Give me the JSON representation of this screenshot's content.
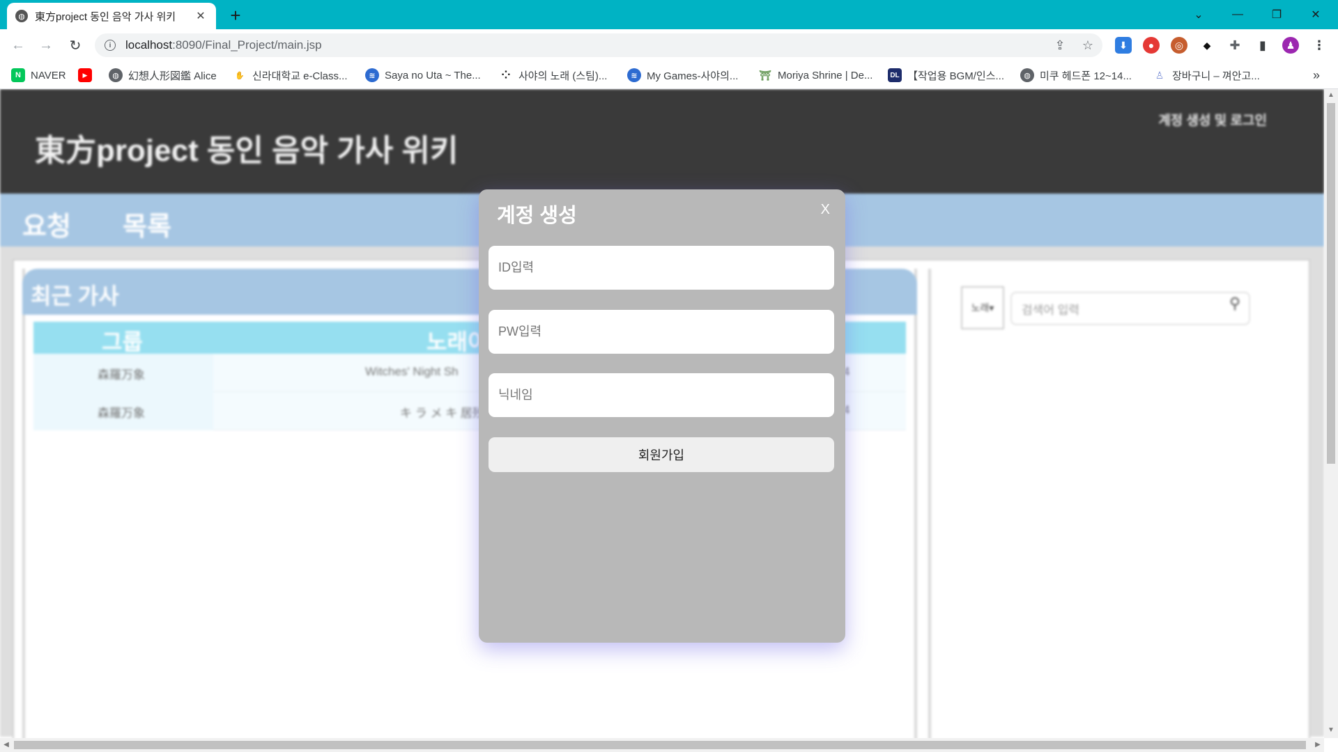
{
  "browser": {
    "tab_title": "東方project 동인 음악 가사 위키",
    "tab_close": "✕",
    "new_tab": "+",
    "url_host": "localhost",
    "url_path": ":8090/Final_Project/main.jsp",
    "window_controls": {
      "tab_search": "⌄",
      "minimize": "—",
      "restore": "❐",
      "close": "✕"
    }
  },
  "bookmarks": [
    {
      "label": "NAVER",
      "icon": "naver-icon",
      "color": "#03c75a",
      "glyph": "N"
    },
    {
      "label": "",
      "icon": "youtube-icon",
      "color": "#ff0000",
      "glyph": "▶"
    },
    {
      "label": "幻想人形図鑑 Alice",
      "icon": "globe-icon",
      "color": "#5f6368",
      "glyph": "◍"
    },
    {
      "label": "신라대학교 e-Class...",
      "icon": "hand-icon",
      "color": "#e9a23b",
      "glyph": "✋"
    },
    {
      "label": "Saya no Uta ~ The...",
      "icon": "site-icon",
      "color": "#2d6bd1",
      "glyph": "≋"
    },
    {
      "label": "사야의 노래 (스팀)...",
      "icon": "dots-icon",
      "color": "#222222",
      "glyph": "⁘"
    },
    {
      "label": "My Games-사야의...",
      "icon": "site-icon",
      "color": "#2d6bd1",
      "glyph": "≋"
    },
    {
      "label": "Moriya Shrine | De...",
      "icon": "shrine-icon",
      "color": "#6a9c5b",
      "glyph": "⛩"
    },
    {
      "label": "【작업용 BGM/인스...",
      "icon": "dl-icon",
      "color": "#1d2c6b",
      "glyph": "DL"
    },
    {
      "label": "미쿠 헤드폰 12~14...",
      "icon": "globe-icon",
      "color": "#5f6368",
      "glyph": "◍"
    },
    {
      "label": "장바구니 – 껴안고...",
      "icon": "figure-icon",
      "color": "#7b8fd6",
      "glyph": "♙"
    }
  ],
  "bookmarks_more": "»",
  "site": {
    "title": "東方project 동인 음악 가사 위키",
    "login_link": "계정 생성 및 로그인",
    "nav": [
      "요청",
      "목록"
    ],
    "recent_title": "최근 가사",
    "table_headers": [
      "그룹",
      "노래이"
    ],
    "rows": [
      {
        "group": "森羅万象",
        "song": "Witches' Night Sh",
        "extra": "4"
      },
      {
        "group": "森羅万象",
        "song": "キ ラ メ キ 居残",
        "extra": "4"
      }
    ],
    "search": {
      "select_value": "노래",
      "placeholder": "검색어 입력",
      "icon": "search-icon"
    }
  },
  "modal": {
    "title": "계정 생성",
    "close": "X",
    "id_placeholder": "ID입력",
    "pw_placeholder": "PW입력",
    "nickname_placeholder": "닉네임",
    "submit": "회원가입"
  },
  "colors": {
    "chrome_accent": "#00b3c4",
    "header_bg": "#3a3a3a",
    "nav_bg": "#a6c6e3",
    "table_header_bg": "#96dff0",
    "modal_bg": "#b8b8b8"
  }
}
